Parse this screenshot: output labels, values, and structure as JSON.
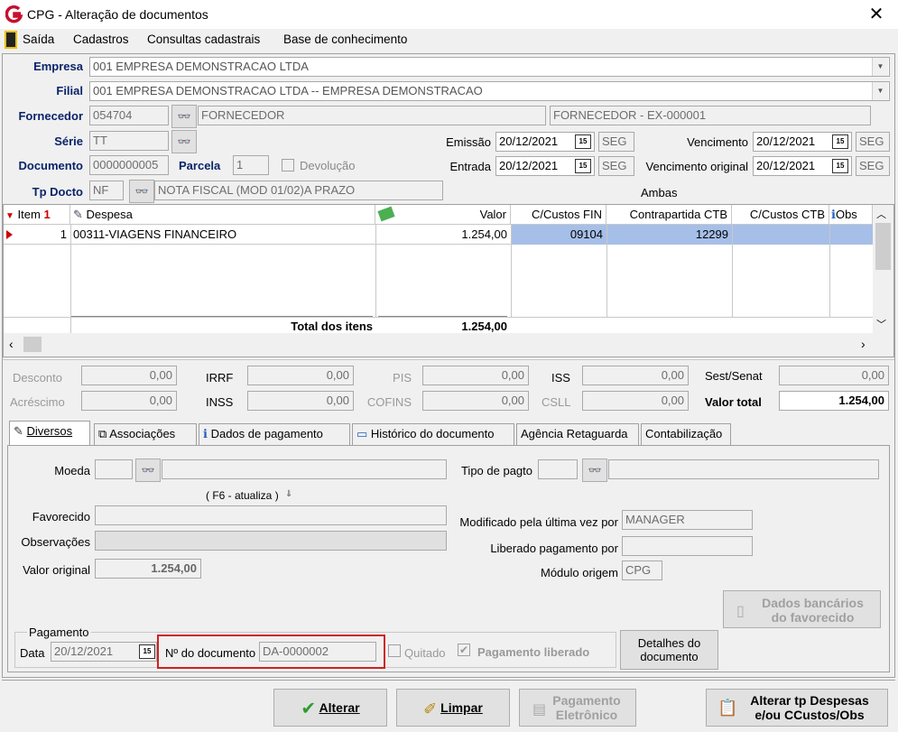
{
  "window": {
    "title": "CPG - Alteração de documentos"
  },
  "menu": [
    "Saída",
    "Cadastros",
    "Consultas cadastrais",
    "Base de conhecimento"
  ],
  "header": {
    "empresa_label": "Empresa",
    "empresa_value": "001 EMPRESA DEMONSTRACAO LTDA",
    "filial_label": "Filial",
    "filial_value": "001 EMPRESA DEMONSTRACAO LTDA -- EMPRESA DEMONSTRACAO",
    "fornecedor_label": "Fornecedor",
    "fornecedor_code": "054704",
    "fornecedor_name": "FORNECEDOR",
    "fornecedor_desc": "FORNECEDOR - EX-000001",
    "serie_label": "Série",
    "serie_value": "TT",
    "documento_label": "Documento",
    "documento_value": "0000000005",
    "parcela_label": "Parcela",
    "parcela_value": "1",
    "devolucao_label": "Devolução",
    "tpdocto_label": "Tp Docto",
    "tpdocto_code": "NF",
    "tpdocto_desc": "NOTA FISCAL (MOD 01/02)A PRAZO",
    "emissao_label": "Emissão",
    "emissao_date": "20/12/2021",
    "emissao_day": "SEG",
    "entrada_label": "Entrada",
    "entrada_date": "20/12/2021",
    "entrada_day": "SEG",
    "vencimento_label": "Vencimento",
    "vencimento_date": "20/12/2021",
    "vencimento_day": "SEG",
    "vencorig_label": "Vencimento original",
    "vencorig_date": "20/12/2021",
    "vencorig_day": "SEG",
    "ambas": "Ambas",
    "cal_icon_text": "15"
  },
  "grid": {
    "columns": [
      "Item",
      "Despesa",
      "Valor",
      "C/Custos FIN",
      "Contrapartida CTB",
      "C/Custos CTB",
      "Obs"
    ],
    "rows": [
      {
        "item": "1",
        "despesa": "00311-VIAGENS FINANCEIRO",
        "valor": "1.254,00",
        "ccfin": "09104",
        "contrapartida": "12299",
        "ccctb": "",
        "obs": ""
      }
    ],
    "total_label": "Total dos itens",
    "total_value": "1.254,00"
  },
  "totals": {
    "desconto_label": "Desconto",
    "desconto": "0,00",
    "acrescimo_label": "Acréscimo",
    "acrescimo": "0,00",
    "irrf_label": "IRRF",
    "irrf": "0,00",
    "inss_label": "INSS",
    "inss": "0,00",
    "pis_label": "PIS",
    "pis": "0,00",
    "cofins_label": "COFINS",
    "cofins": "0,00",
    "iss_label": "ISS",
    "iss": "0,00",
    "csll_label": "CSLL",
    "csll": "0,00",
    "sest_label": "Sest/Senat",
    "sest": "0,00",
    "valortotal_label": "Valor total",
    "valortotal": "1.254,00"
  },
  "tabs": [
    "Diversos",
    "Associações",
    "Dados de pagamento",
    "Histórico do documento",
    "Agência Retaguarda",
    "Contabilização"
  ],
  "diversos": {
    "moeda_label": "Moeda",
    "tipopagto_label": "Tipo de pagto",
    "f6_hint": "( F6 - atualiza )",
    "favorecido_label": "Favorecido",
    "observacoes_label": "Observações",
    "valororiginal_label": "Valor original",
    "valororiginal": "1.254,00",
    "modificado_label": "Modificado pela última vez por",
    "modificado": "MANAGER",
    "liberado_label": "Liberado pagamento por",
    "liberado": "",
    "modulo_label": "Módulo origem",
    "modulo": "CPG",
    "dados_bancarios_line1": "Dados bancários",
    "dados_bancarios_line2": "do favorecido",
    "pagamento_group": "Pagamento",
    "data_label": "Data",
    "data_value": "20/12/2021",
    "ndoc_label": "Nº do documento",
    "ndoc_value": "DA-0000002",
    "quitado_label": "Quitado",
    "pagliberado_label": "Pagamento liberado",
    "detalhes_line1": "Detalhes do",
    "detalhes_line2": "documento"
  },
  "buttons": {
    "alterar": "Alterar",
    "limpar": "Limpar",
    "pagel_line1": "Pagamento",
    "pagel_line2": "Eletrônico",
    "altertp_line1": "Alterar tp Despesas",
    "altertp_line2": "e/ou CCustos/Obs"
  },
  "colors": {
    "accent_label": "#0a246a",
    "selection": "#a6bfe8",
    "highlight_box": "#d02020"
  }
}
